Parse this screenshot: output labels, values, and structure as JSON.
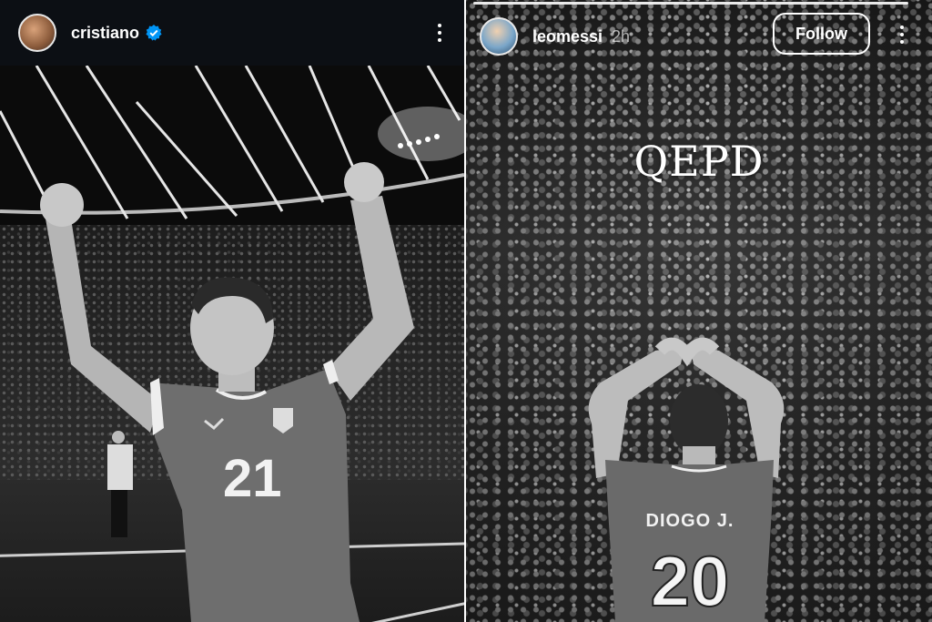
{
  "left_story": {
    "username": "cristiano",
    "verified": true,
    "jersey_number": "21"
  },
  "right_story": {
    "username": "leomessi",
    "time_ago": "2h",
    "follow_label": "Follow",
    "overlay_text": "QEPD",
    "jersey_name": "DIOGO J.",
    "jersey_number": "20"
  },
  "icons": {
    "verified": "verified-badge-icon",
    "more": "more-vertical-icon"
  },
  "colors": {
    "header_bg": "#0c0f14",
    "verified_blue": "#0095f6",
    "text": "#ffffff"
  }
}
